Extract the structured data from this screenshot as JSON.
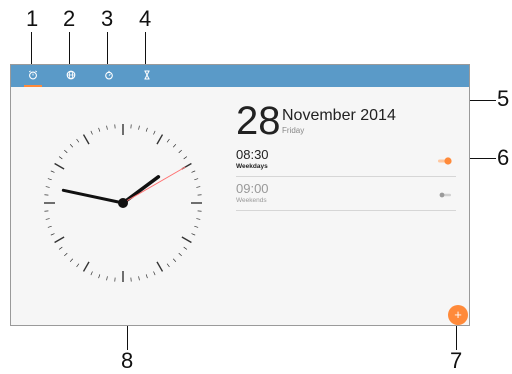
{
  "callouts": [
    "1",
    "2",
    "3",
    "4",
    "5",
    "6",
    "7",
    "8"
  ],
  "tabs": [
    {
      "icon": "alarm-icon",
      "active": true
    },
    {
      "icon": "world-clock-icon",
      "active": false
    },
    {
      "icon": "stopwatch-icon",
      "active": false
    },
    {
      "icon": "timer-icon",
      "active": false
    }
  ],
  "date": {
    "day": "28",
    "month_year": "November 2014",
    "weekday": "Friday"
  },
  "alarms": [
    {
      "time": "08:30",
      "days": "Weekdays",
      "enabled": true
    },
    {
      "time": "09:00",
      "days": "Weekends",
      "enabled": false
    }
  ],
  "add_button": {
    "label": "+"
  },
  "clock": {
    "hour": 1,
    "minute": 47,
    "second": 10
  },
  "colors": {
    "topbar": "#5a9ac8",
    "accent": "#ff8a3a",
    "second_hand": "#ff7070"
  }
}
